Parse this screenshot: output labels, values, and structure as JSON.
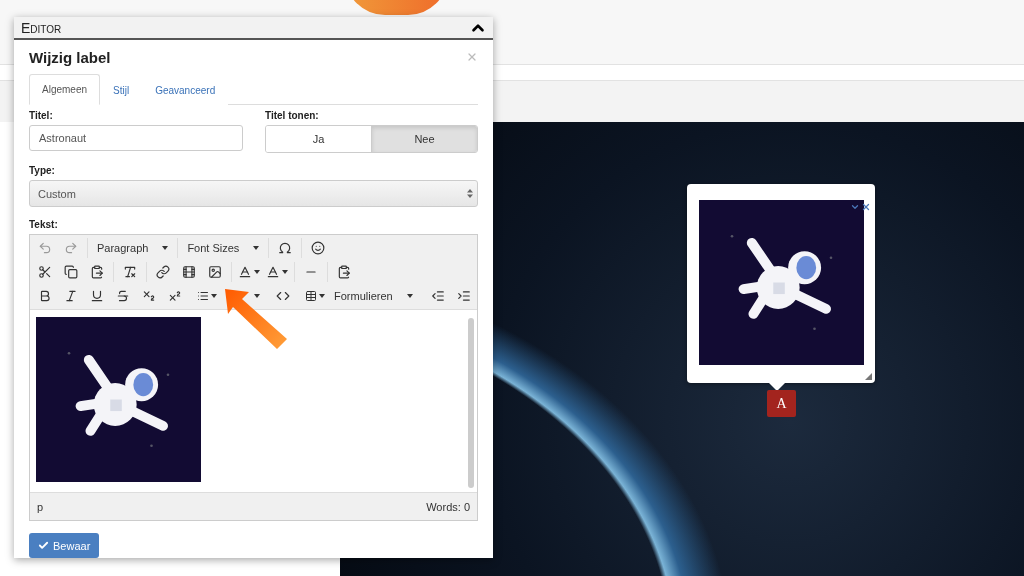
{
  "panel": {
    "title": "Editor"
  },
  "dialog": {
    "title": "Wijzig label"
  },
  "tabs": [
    {
      "label": "Algemeen",
      "selected": true
    },
    {
      "label": "Stijl",
      "selected": false
    },
    {
      "label": "Geavanceerd",
      "selected": false
    }
  ],
  "title_field": {
    "label": "Titel:",
    "value": "Astronaut"
  },
  "show_title": {
    "label": "Titel tonen:",
    "options": [
      {
        "label": "Ja",
        "selected": false
      },
      {
        "label": "Nee",
        "selected": true
      }
    ]
  },
  "type_field": {
    "label": "Type:",
    "value": "Custom"
  },
  "text_editor": {
    "label": "Tekst:",
    "dropdowns": [
      "Paragraph",
      "Font Sizes",
      "Formulieren"
    ],
    "status_path": "p",
    "word_count": "Words: 0"
  },
  "save_button": "Bewaar",
  "marker": {
    "label": "A"
  }
}
